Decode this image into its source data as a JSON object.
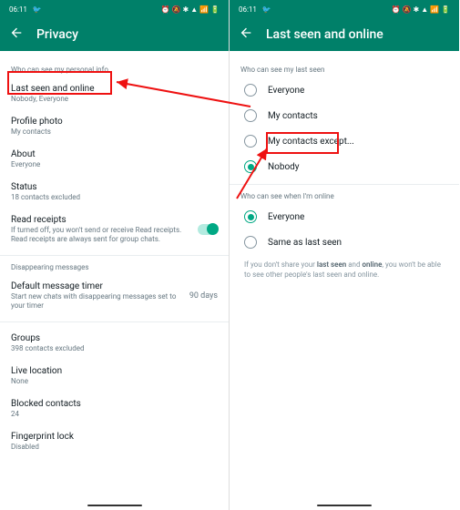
{
  "status": {
    "time": "06:11",
    "icons": "⏰ 🔕 ✱ ▲ 📶 🔋"
  },
  "left": {
    "title": "Privacy",
    "section1": "Who can see my personal info",
    "items": [
      {
        "title": "Last seen and online",
        "sub": "Nobody, Everyone"
      },
      {
        "title": "Profile photo",
        "sub": "My contacts"
      },
      {
        "title": "About",
        "sub": "Everyone"
      },
      {
        "title": "Status",
        "sub": "18 contacts excluded"
      }
    ],
    "read": {
      "title": "Read receipts",
      "sub": "If turned off, you won't send or receive Read receipts. Read receipts are always sent for group chats."
    },
    "section2": "Disappearing messages",
    "dmt": {
      "title": "Default message timer",
      "sub": "Start new chats with disappearing messages set to your timer",
      "right": "90 days"
    },
    "more": [
      {
        "title": "Groups",
        "sub": "398 contacts excluded"
      },
      {
        "title": "Live location",
        "sub": "None"
      },
      {
        "title": "Blocked contacts",
        "sub": "24"
      },
      {
        "title": "Fingerprint lock",
        "sub": "Disabled"
      }
    ]
  },
  "right": {
    "title": "Last seen and online",
    "section1": "Who can see my last seen",
    "opts1": [
      "Everyone",
      "My contacts",
      "My contacts except...",
      "Nobody"
    ],
    "selected1": 3,
    "section2": "Who can see when I'm online",
    "opts2": [
      "Everyone",
      "Same as last seen"
    ],
    "selected2": 0,
    "hint_pre": "If you don't share your ",
    "hint_b1": "last seen",
    "hint_mid": " and ",
    "hint_b2": "online",
    "hint_post": ", you won't be able to see other people's last seen and online."
  }
}
